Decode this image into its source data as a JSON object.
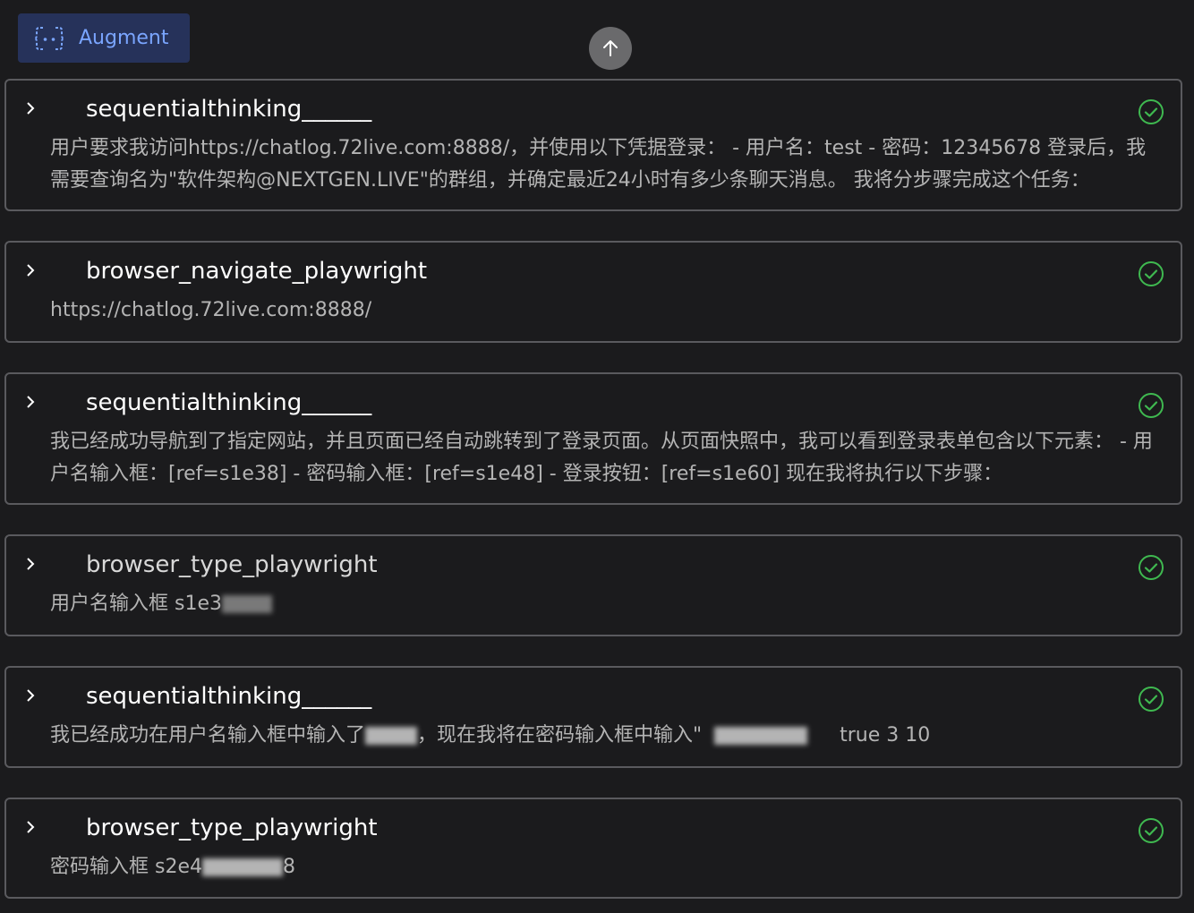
{
  "header": {
    "badge_label": "Augment",
    "badge_icon": "augment-bracket-icon",
    "scroll_icon": "arrow-up-icon"
  },
  "colors": {
    "background": "#1b1b1d",
    "card_border": "#5a5a5e",
    "badge_bg": "#26325a",
    "badge_text": "#7aa5ff",
    "success": "#3fb950"
  },
  "cards": [
    {
      "title": "sequentialthinking______",
      "body": "用户要求我访问https://chatlog.72live.com:8888/，并使用以下凭据登录： - 用户名：test - 密码：12345678 登录后，我需要查询名为\"软件架构@NEXTGEN.LIVE\"的群组，并确定最近24小时有多少条聊天消息。 我将分步骤完成这个任务：",
      "status_icon": "check-circle-icon"
    },
    {
      "title": "browser_navigate_playwright",
      "body": "https://chatlog.72live.com:8888/",
      "status_icon": "check-circle-icon"
    },
    {
      "title": "sequentialthinking______",
      "body": "我已经成功导航到了指定网站，并且页面已经自动跳转到了登录页面。从页面快照中，我可以看到登录表单包含以下元素： - 用户名输入框：[ref=s1e38] - 密码输入框：[ref=s1e48] - 登录按钮：[ref=s1e60] 现在我将执行以下步骤：",
      "status_icon": "check-circle-icon"
    },
    {
      "title": "browser_type_playwright",
      "body_prefix": "用户名输入框 s1e3",
      "status_icon": "check-circle-icon"
    },
    {
      "title": "sequentialthinking______",
      "body_prefix": "我已经成功在用户名输入框中输入了",
      "body_middle": "，现在我将在密码输入框中输入\"",
      "body_suffix": "true 3 10",
      "status_icon": "check-circle-icon"
    },
    {
      "title": "browser_type_playwright",
      "body_prefix": "密码输入框 s2e4",
      "body_suffix": "8",
      "status_icon": "check-circle-icon"
    }
  ]
}
